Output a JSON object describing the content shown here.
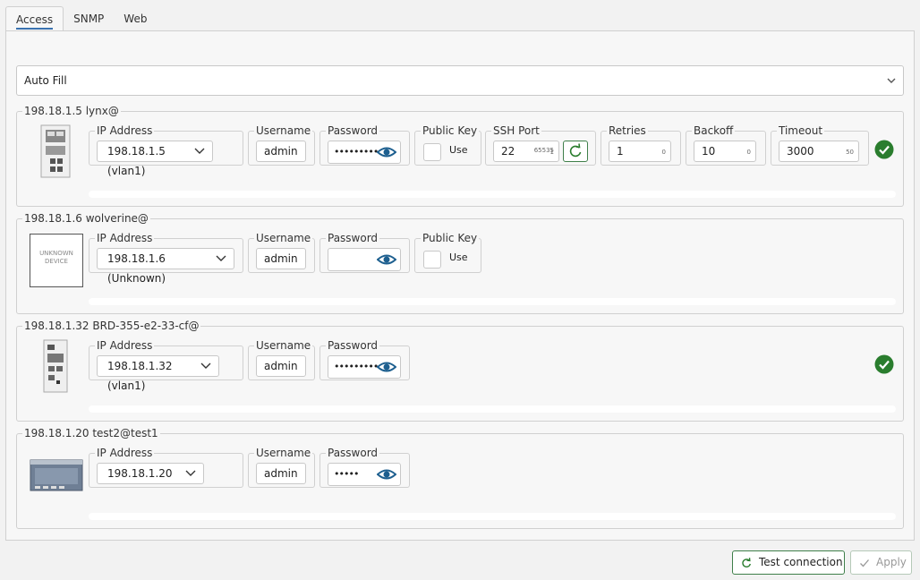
{
  "tabs": [
    {
      "label": "Access"
    },
    {
      "label": "SNMP"
    },
    {
      "label": "Web"
    }
  ],
  "auto_fill": {
    "label": "Auto Fill"
  },
  "group_labels": {
    "ip": "IP Address",
    "username": "Username",
    "password": "Password",
    "public_key": "Public Key",
    "ssh_port": "SSH Port",
    "retries": "Retries",
    "backoff": "Backoff",
    "timeout": "Timeout",
    "use": "Use"
  },
  "devices": [
    {
      "title": "198.18.1.5 lynx@",
      "ip_select": "198.18.1.5 (vlan1)",
      "username": "admin",
      "password_mask": "•••••••••",
      "ssh_port": {
        "value": "22",
        "max": "65535",
        "min": "1"
      },
      "retries": {
        "value": "1",
        "min": "0"
      },
      "backoff": {
        "value": "10",
        "min": "0"
      },
      "timeout": {
        "value": "3000",
        "min": "50"
      },
      "status": "ok"
    },
    {
      "title": "198.18.1.6 wolverine@",
      "thumb_text": [
        "UNKNOWN",
        "DEVICE"
      ],
      "ip_select": "198.18.1.6 (Unknown)",
      "username": "admin",
      "password_mask": ""
    },
    {
      "title": "198.18.1.32 BRD-355-e2-33-cf@",
      "ip_select": "198.18.1.32 (vlan1)",
      "username": "admin",
      "password_mask": "•••••••••",
      "status": "ok"
    },
    {
      "title": "198.18.1.20 test2@test1",
      "ip_select": "198.18.1.20",
      "username": "admin",
      "password_mask": "•••••"
    }
  ],
  "footer": {
    "test_connection": "Test connection",
    "apply": "Apply"
  },
  "colors": {
    "accent_blue": "#1d5f8f",
    "ok_green": "#2a7d2e",
    "tab_underline": "#3a72b0"
  }
}
